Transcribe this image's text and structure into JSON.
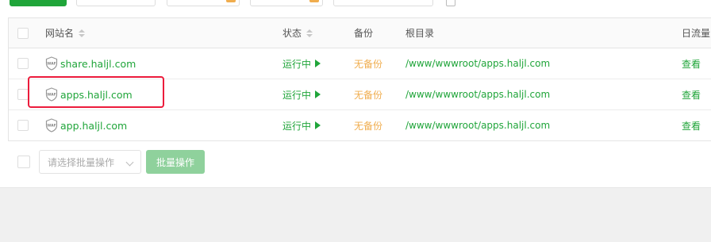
{
  "columns": {
    "name": "网站名",
    "status": "状态",
    "backup": "备份",
    "root": "根目录",
    "traffic": "日流量"
  },
  "sites": [
    {
      "name": "share.haljl.com",
      "status": "运行中",
      "backup": "无备份",
      "root": "/www/wwwroot/apps.haljl.com",
      "traffic": "查看"
    },
    {
      "name": "apps.haljl.com",
      "status": "运行中",
      "backup": "无备份",
      "root": "/www/wwwroot/apps.haljl.com",
      "traffic": "查看"
    },
    {
      "name": "app.haljl.com",
      "status": "运行中",
      "backup": "无备份",
      "root": "/www/wwwroot/apps.haljl.com",
      "traffic": "查看"
    }
  ],
  "batch": {
    "select_placeholder": "请选择批量操作",
    "button_label": "批量操作"
  },
  "waf_label": "WAF",
  "colors": {
    "accent": "#20a53a",
    "warning": "#f0ad4e",
    "highlight": "#ec1c3c"
  }
}
